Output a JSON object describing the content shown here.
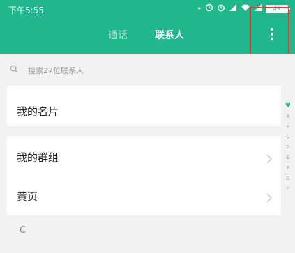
{
  "status_bar": {
    "time": "下午5:55",
    "battery": "49"
  },
  "tabs": [
    {
      "label": "通话",
      "active": false
    },
    {
      "label": "联系人",
      "active": true
    }
  ],
  "search": {
    "placeholder": "搜索27位联系人"
  },
  "list": {
    "my_card": "我的名片",
    "my_groups": "我的群组",
    "yellow_pages": "黄页",
    "section_letter": "C"
  },
  "index_bar": [
    "A",
    "B",
    "C",
    "D",
    "E",
    "F",
    "G",
    "H"
  ],
  "colors": {
    "header": "#1fb78b",
    "highlight_box": "#e53935"
  }
}
